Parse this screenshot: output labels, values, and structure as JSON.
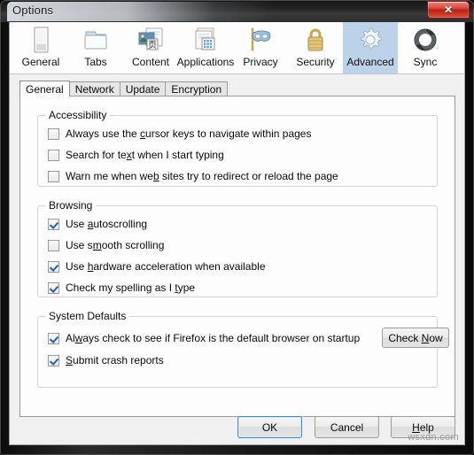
{
  "window": {
    "title": "Options",
    "close_label": "✕"
  },
  "iconbar": {
    "items": [
      {
        "label": "General",
        "icon": "page-icon",
        "selected": false
      },
      {
        "label": "Tabs",
        "icon": "folder-icon",
        "selected": false
      },
      {
        "label": "Content",
        "icon": "content-icon",
        "selected": false
      },
      {
        "label": "Applications",
        "icon": "applications-icon",
        "selected": false
      },
      {
        "label": "Privacy",
        "icon": "mask-icon",
        "selected": false
      },
      {
        "label": "Security",
        "icon": "padlock-icon",
        "selected": false
      },
      {
        "label": "Advanced",
        "icon": "gear-icon",
        "selected": true
      },
      {
        "label": "Sync",
        "icon": "sync-icon",
        "selected": false
      }
    ],
    "selected_color": "#bcd2e8"
  },
  "tabs": [
    {
      "label": "General",
      "active": true
    },
    {
      "label": "Network",
      "active": false
    },
    {
      "label": "Update",
      "active": false
    },
    {
      "label": "Encryption",
      "active": false
    }
  ],
  "groups": {
    "accessibility": {
      "title": "Accessibility",
      "items": [
        {
          "pre": "Always use the ",
          "acc": "c",
          "post": "ursor keys to navigate within pages",
          "checked": false
        },
        {
          "pre": "Search for te",
          "acc": "x",
          "post": "t when I start typing",
          "checked": false
        },
        {
          "pre": "Warn me when we",
          "acc": "b",
          "post": " sites try to redirect or reload the page",
          "checked": false
        }
      ]
    },
    "browsing": {
      "title": "Browsing",
      "items": [
        {
          "pre": "Use ",
          "acc": "a",
          "post": "utoscrolling",
          "checked": true
        },
        {
          "pre": "Use s",
          "acc": "m",
          "post": "ooth scrolling",
          "checked": false
        },
        {
          "pre": "Use ",
          "acc": "h",
          "post": "ardware acceleration when available",
          "checked": true
        },
        {
          "pre": "Check my spelling as I ",
          "acc": "t",
          "post": "ype",
          "checked": true
        }
      ]
    },
    "system_defaults": {
      "title": "System Defaults",
      "items": [
        {
          "pre": "Al",
          "acc": "w",
          "post": "ays check to see if Firefox is the default browser on startup",
          "checked": true
        },
        {
          "pre": "",
          "acc": "S",
          "post": "ubmit crash reports",
          "checked": true
        }
      ],
      "check_now": {
        "pre": "Check ",
        "acc": "N",
        "post": "ow"
      }
    }
  },
  "footer": {
    "ok": {
      "pre": "OK",
      "acc": "",
      "post": "",
      "default": true
    },
    "cancel": {
      "pre": "Cancel",
      "acc": "",
      "post": "",
      "default": false
    },
    "help": {
      "pre": "",
      "acc": "H",
      "post": "elp",
      "default": false
    }
  },
  "watermark": "wsxdn.com"
}
